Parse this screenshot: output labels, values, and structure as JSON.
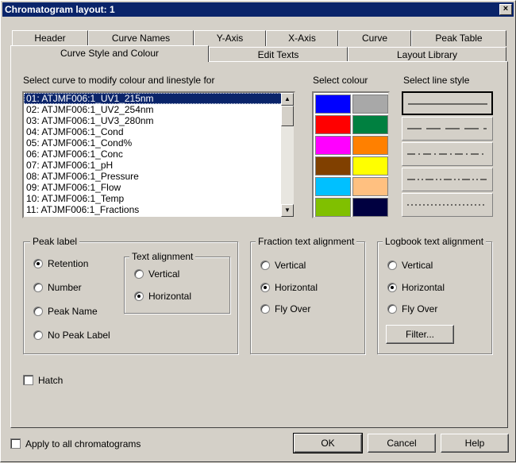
{
  "window": {
    "title": "Chromatogram layout: 1",
    "close": "×"
  },
  "tabs_row1": [
    "Header",
    "Curve Names",
    "Y-Axis",
    "X-Axis",
    "Curve",
    "Peak Table"
  ],
  "tabs_row2": [
    "Curve Style and Colour",
    "Edit Texts",
    "Layout Library"
  ],
  "curve_section": {
    "label": "Select curve to modify colour and linestyle for",
    "items": [
      "01: ATJMF006:1_UV1_215nm",
      "02: ATJMF006:1_UV2_254nm",
      "03: ATJMF006:1_UV3_280nm",
      "04: ATJMF006:1_Cond",
      "05: ATJMF006:1_Cond%",
      "06: ATJMF006:1_Conc",
      "07: ATJMF006:1_pH",
      "08: ATJMF006:1_Pressure",
      "09: ATJMF006:1_Flow",
      "10: ATJMF006:1_Temp",
      "11: ATJMF006:1_Fractions"
    ],
    "selected_index": 0
  },
  "colour_section": {
    "label": "Select colour",
    "colors": [
      "#0000ff",
      "#a8a8a8",
      "#ff0000",
      "#008040",
      "#ff00ff",
      "#ff8000",
      "#804000",
      "#ffff00",
      "#00c0ff",
      "#ffc080",
      "#80c000",
      "#000040"
    ]
  },
  "linestyle_section": {
    "label": "Select line style",
    "styles": [
      "solid",
      "dashed",
      "dash-dot",
      "dash-dot-dot",
      "dotted"
    ],
    "selected_index": 0
  },
  "peak_label": {
    "title": "Peak label",
    "options": [
      "Retention",
      "Number",
      "Peak Name",
      "No Peak Label"
    ],
    "selected": 0,
    "text_alignment": {
      "title": "Text alignment",
      "options": [
        "Vertical",
        "Horizontal"
      ],
      "selected": 1
    }
  },
  "fraction_text": {
    "title": "Fraction text alignment",
    "options": [
      "Vertical",
      "Horizontal",
      "Fly Over"
    ],
    "selected": 1
  },
  "logbook_text": {
    "title": "Logbook text alignment",
    "options": [
      "Vertical",
      "Horizontal",
      "Fly Over"
    ],
    "selected": 1,
    "filter_label": "Filter..."
  },
  "hatch": {
    "label": "Hatch",
    "checked": false
  },
  "apply_all": {
    "label": "Apply to all chromatograms",
    "checked": false
  },
  "buttons": {
    "ok": "OK",
    "cancel": "Cancel",
    "help": "Help"
  }
}
